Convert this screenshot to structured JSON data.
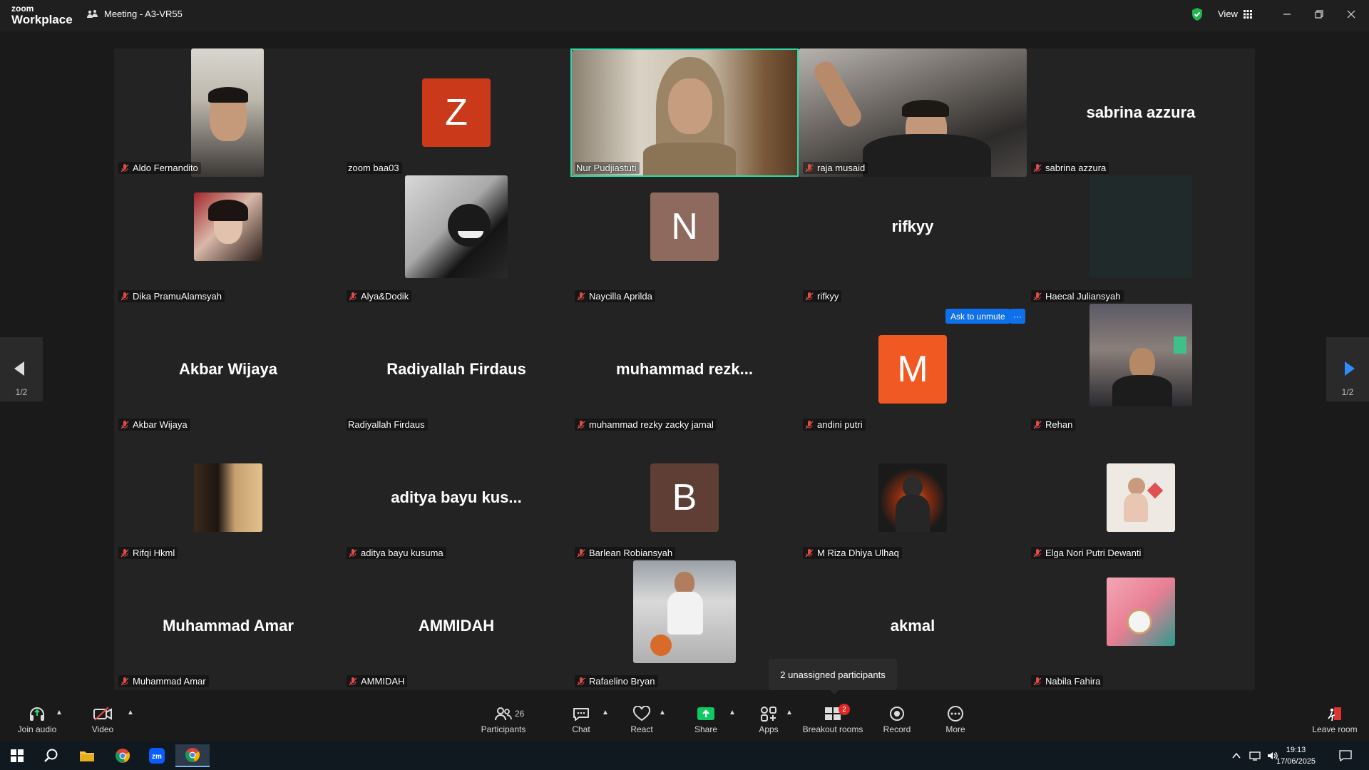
{
  "app": {
    "brand_top": "zoom",
    "brand_bottom": "Workplace",
    "meeting_title": "Meeting - A3-VR55",
    "view_label": "View"
  },
  "colors": {
    "active_speaker": "#2fd9a6",
    "muted_mic": "#e04a4a",
    "accent_blue": "#0e71eb",
    "share_green": "#0fca62"
  },
  "participants": [
    {
      "name": "Aldo Fernandito",
      "muted": true,
      "display": "video"
    },
    {
      "name": "zoom baa03",
      "muted": false,
      "display": "letter",
      "letter": "Z",
      "color": "#c9391a"
    },
    {
      "name": "Nur Pudjiastuti",
      "muted": false,
      "display": "video",
      "active": true
    },
    {
      "name": "raja musaid",
      "muted": true,
      "display": "video"
    },
    {
      "name": "sabrina azzura",
      "muted": true,
      "display": "name",
      "big_name": "sabrina azzura"
    },
    {
      "name": "Dika PramuAlamsyah",
      "muted": true,
      "display": "photo"
    },
    {
      "name": "Alya&Dodik",
      "muted": true,
      "display": "photo"
    },
    {
      "name": "Naycilla Aprilda",
      "muted": true,
      "display": "letter",
      "letter": "N",
      "color": "#8e6a5e"
    },
    {
      "name": "rifkyy",
      "muted": true,
      "display": "name",
      "big_name": "rifkyy"
    },
    {
      "name": "Haecal Juliansyah",
      "muted": true,
      "display": "photo"
    },
    {
      "name": "Akbar Wijaya",
      "muted": true,
      "display": "name",
      "big_name": "Akbar Wijaya"
    },
    {
      "name": "Radiyallah Firdaus",
      "muted": false,
      "display": "name",
      "big_name": "Radiyallah Firdaus"
    },
    {
      "name": "muhammad rezky zacky jamal",
      "muted": true,
      "display": "name",
      "big_name": "muhammad  rezk..."
    },
    {
      "name": "andini putri",
      "muted": true,
      "display": "letter",
      "letter": "M",
      "color": "#f05a22"
    },
    {
      "name": "Rehan",
      "muted": true,
      "display": "photo"
    },
    {
      "name": "Rifqi Hkml",
      "muted": true,
      "display": "photo"
    },
    {
      "name": "aditya bayu kusuma",
      "muted": true,
      "display": "name",
      "big_name": "aditya bayu kus..."
    },
    {
      "name": "Barlean Robiansyah",
      "muted": true,
      "display": "letter",
      "letter": "B",
      "color": "#5e3e35"
    },
    {
      "name": "M Riza Dhiya Ulhaq",
      "muted": true,
      "display": "photo"
    },
    {
      "name": "Elga Nori Putri Dewanti",
      "muted": true,
      "display": "photo"
    },
    {
      "name": "Muhammad Amar",
      "muted": true,
      "display": "name",
      "big_name": "Muhammad Amar"
    },
    {
      "name": "AMMIDAH",
      "muted": true,
      "display": "name",
      "big_name": "AMMIDAH"
    },
    {
      "name": "Rafaelino Bryan",
      "muted": true,
      "display": "photo"
    },
    {
      "name": "",
      "muted": false,
      "display": "name",
      "big_name": "akmal"
    },
    {
      "name": "Nabila Fahira",
      "muted": true,
      "display": "photo"
    }
  ],
  "pager": {
    "left": "1/2",
    "right": "1/2"
  },
  "ask_to_unmute": "Ask to unmute",
  "ask_more": "···",
  "tooltip": "2 unassigned participants",
  "toolbar": {
    "join_audio": "Join audio",
    "video": "Video",
    "participants": "Participants",
    "participants_count": "26",
    "chat": "Chat",
    "react": "React",
    "share": "Share",
    "apps": "Apps",
    "breakout": "Breakout rooms",
    "breakout_badge": "2",
    "record": "Record",
    "more": "More",
    "leave": "Leave room"
  },
  "taskbar": {
    "time": "19:13",
    "date": "17/06/2025"
  }
}
